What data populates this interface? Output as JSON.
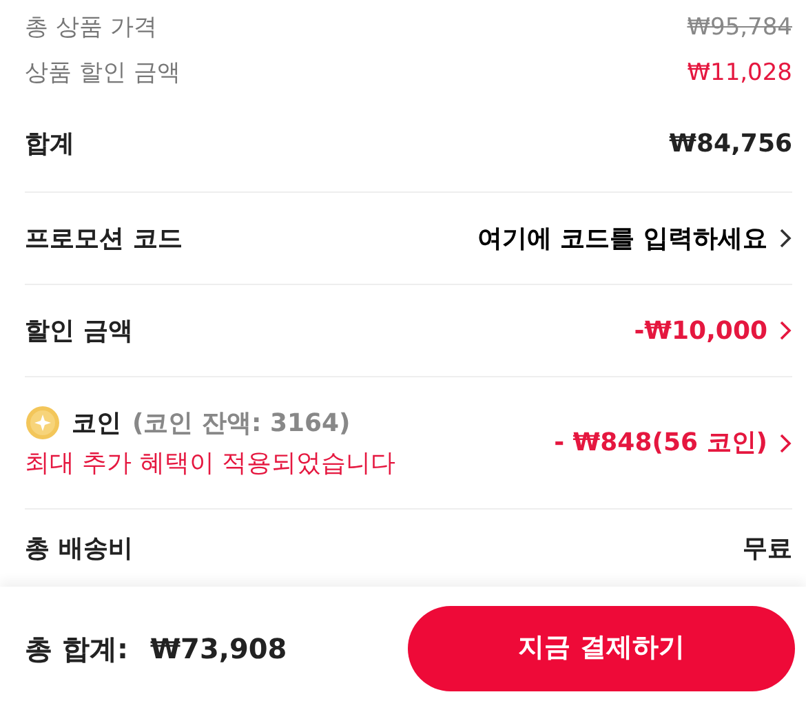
{
  "price_lines": [
    {
      "kind": "strike",
      "label": "총 상품 가격",
      "value": "₩95,784"
    },
    {
      "kind": "discount",
      "label": "상품 할인 금액",
      "value": "₩11,028"
    }
  ],
  "subtotal": {
    "label": "합계",
    "value": "₩84,756"
  },
  "rows": [
    {
      "kind": "plain",
      "label": "프로모션 코드",
      "value": "여기에 코드를 입력하세요"
    },
    {
      "kind": "discount",
      "label": "할인 금액",
      "value": "-₩10,000"
    }
  ],
  "coin": {
    "label": "코인",
    "balance": "(코인 잔액: 3164)",
    "note": "최대 추가 혜택이 적용되었습니다",
    "value": "- ₩848(56 코인)"
  },
  "shipping": {
    "label": "총 배송비",
    "value": "무료"
  },
  "footer": {
    "label": "총 합계:",
    "value": "₩73,908",
    "button": "지금 결제하기"
  }
}
